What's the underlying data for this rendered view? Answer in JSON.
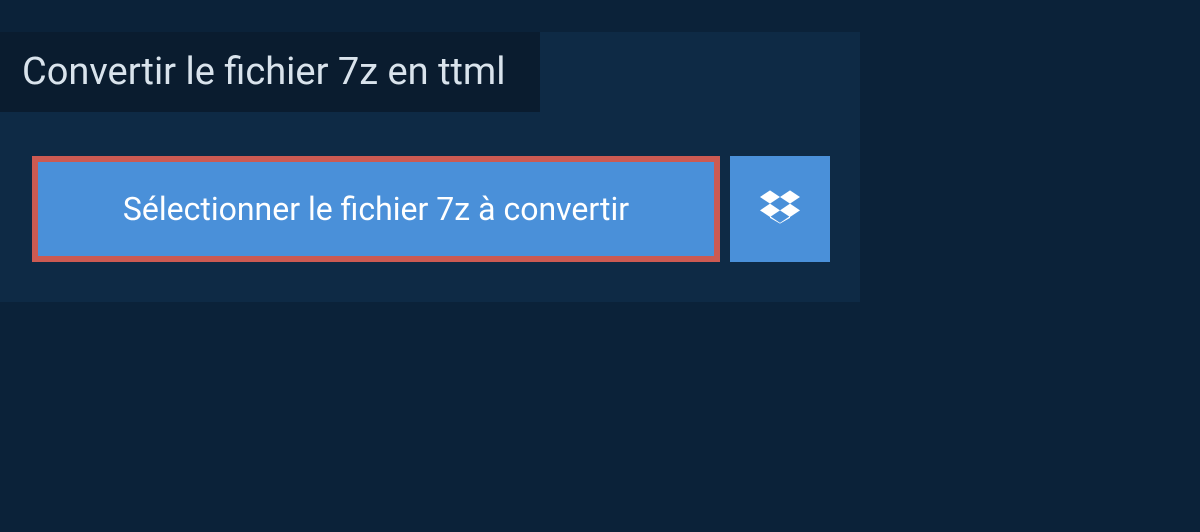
{
  "header": {
    "title": "Convertir le fichier 7z en ttml"
  },
  "actions": {
    "select_file_label": "Sélectionner le fichier 7z à convertir"
  }
}
